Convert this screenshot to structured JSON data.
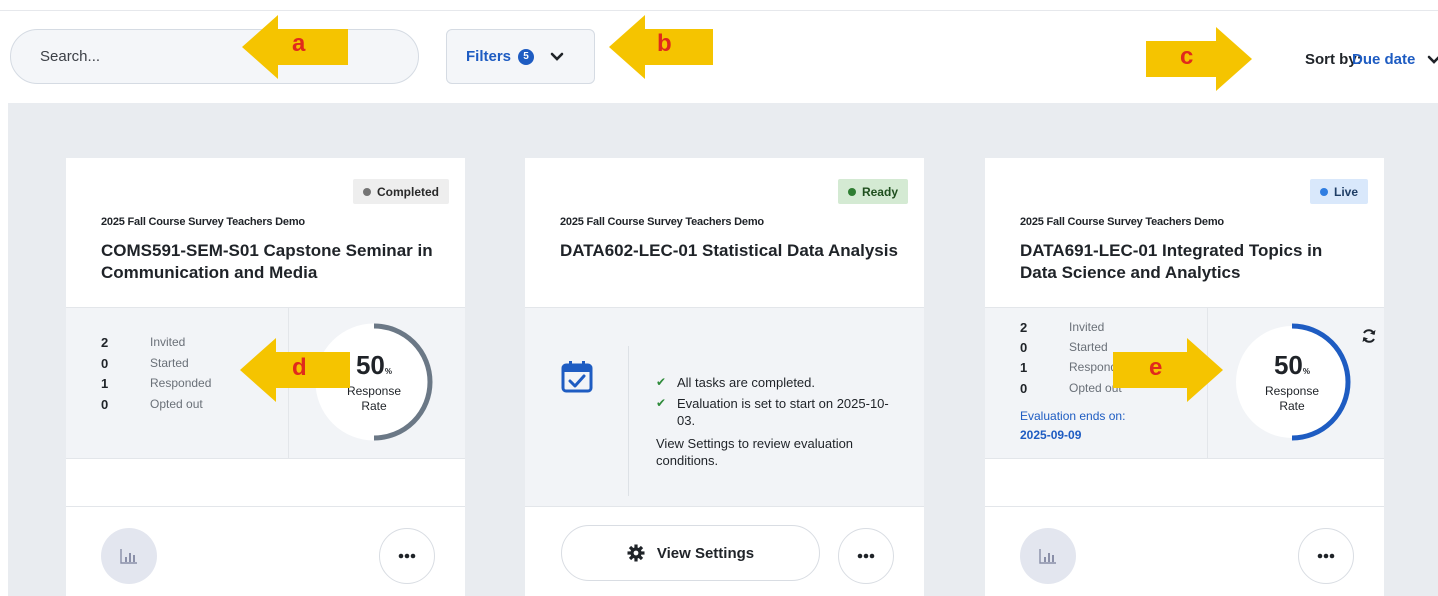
{
  "toolbar": {
    "search_placeholder": "Search...",
    "filters_label": "Filters",
    "filters_count": "5",
    "sort_label": "Sort by:",
    "sort_value": "Due date"
  },
  "cards": [
    {
      "status": "Completed",
      "term": "2025 Fall Course Survey Teachers Demo",
      "title": "COMS591-SEM-S01 Capstone Seminar in Communication and Media",
      "stats": [
        {
          "value": "2",
          "label": "Invited"
        },
        {
          "value": "0",
          "label": "Started"
        },
        {
          "value": "1",
          "label": "Responded"
        },
        {
          "value": "0",
          "label": "Opted out"
        }
      ],
      "rate": "50",
      "rate_unit": "%",
      "rate_label_1": "Response",
      "rate_label_2": "Rate",
      "rate_fraction": 0.5,
      "ring_color": "#6b7886"
    },
    {
      "status": "Ready",
      "term": "2025 Fall Course Survey Teachers Demo",
      "title": "DATA602-LEC-01 Statistical Data Analysis",
      "tasks": [
        "All tasks are completed.",
        "Evaluation is set to start on 2025-10-03."
      ],
      "note": "View Settings to review evaluation conditions.",
      "button": "View Settings"
    },
    {
      "status": "Live",
      "term": "2025 Fall Course Survey Teachers Demo",
      "title": "DATA691-LEC-01 Integrated Topics in Data Science and Analytics",
      "stats": [
        {
          "value": "2",
          "label": "Invited"
        },
        {
          "value": "0",
          "label": "Started"
        },
        {
          "value": "1",
          "label": "Respond"
        },
        {
          "value": "0",
          "label": "Opted out"
        }
      ],
      "ends_label": "Evaluation ends on:",
      "ends_date": "2025-09-09",
      "rate": "50",
      "rate_unit": "%",
      "rate_label_1": "Response",
      "rate_label_2": "Rate",
      "rate_fraction": 0.5,
      "ring_color": "#1e5cc2"
    }
  ],
  "annotations": [
    "a",
    "b",
    "c",
    "d",
    "e"
  ],
  "colors": {
    "accent": "#1e5cc2",
    "arrow": "#f5c400",
    "arrow_label": "#e02a1c"
  }
}
